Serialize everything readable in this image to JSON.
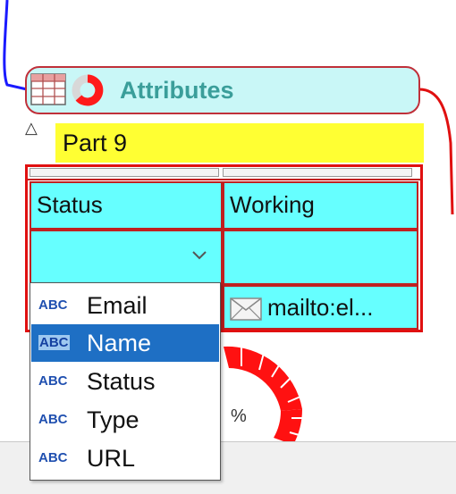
{
  "node": {
    "title": "Attributes",
    "part_label": "Part 9",
    "collapse_glyph": "△"
  },
  "grid": {
    "rows": [
      [
        "Status",
        "Working"
      ],
      [
        "",
        ""
      ],
      [
        "",
        "mailto:el..."
      ]
    ]
  },
  "donut": {
    "percent_label": "%"
  },
  "menu": {
    "badge": "ABC",
    "selected_index": 1,
    "items": [
      {
        "label": "Email"
      },
      {
        "label": "Name"
      },
      {
        "label": "Status"
      },
      {
        "label": "Type"
      },
      {
        "label": "URL"
      }
    ]
  },
  "colors": {
    "accent_red": "#e01010",
    "cell_cyan": "#66ffff",
    "header_cyan": "#c9f7f7",
    "label_yellow": "#ffff33",
    "selection_blue": "#1e6fc4",
    "title_teal": "#3a9e9a"
  },
  "icons": [
    "table-icon",
    "donut-chart-icon",
    "chevron-down-icon",
    "mail-icon",
    "abc-type-icon"
  ]
}
